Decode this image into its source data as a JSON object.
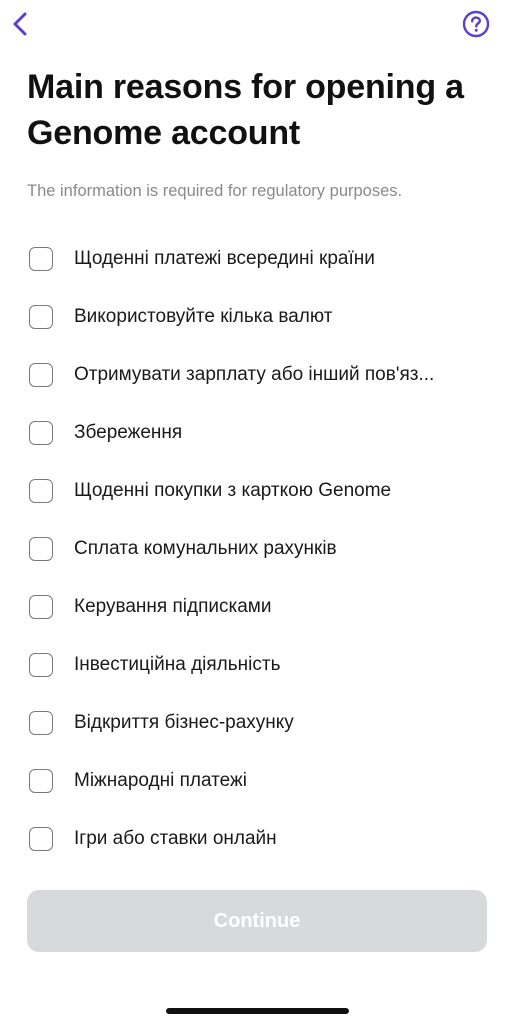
{
  "header": {
    "back_icon": "chevron-left-icon",
    "help_icon": "question-circle-icon",
    "accent_color": "#5b3fd1"
  },
  "title": "Main reasons for opening a Genome account",
  "subtitle": "The information is required for regulatory purposes.",
  "options": [
    {
      "label": "Щоденні платежі всередині країни",
      "checked": false
    },
    {
      "label": "Використовуйте кілька валют",
      "checked": false
    },
    {
      "label": "Отримувати зарплату або інший пов'яз...",
      "checked": false
    },
    {
      "label": "Збереження",
      "checked": false
    },
    {
      "label": "Щоденні покупки з карткою Genome",
      "checked": false
    },
    {
      "label": "Сплата комунальних рахунків",
      "checked": false
    },
    {
      "label": "Керування підписками",
      "checked": false
    },
    {
      "label": "Інвестиційна діяльність",
      "checked": false
    },
    {
      "label": "Відкриття бізнес-рахунку",
      "checked": false
    },
    {
      "label": "Міжнародні платежі",
      "checked": false
    },
    {
      "label": "Ігри або ставки онлайн",
      "checked": false
    }
  ],
  "continue_button": {
    "label": "Continue",
    "disabled": true
  }
}
